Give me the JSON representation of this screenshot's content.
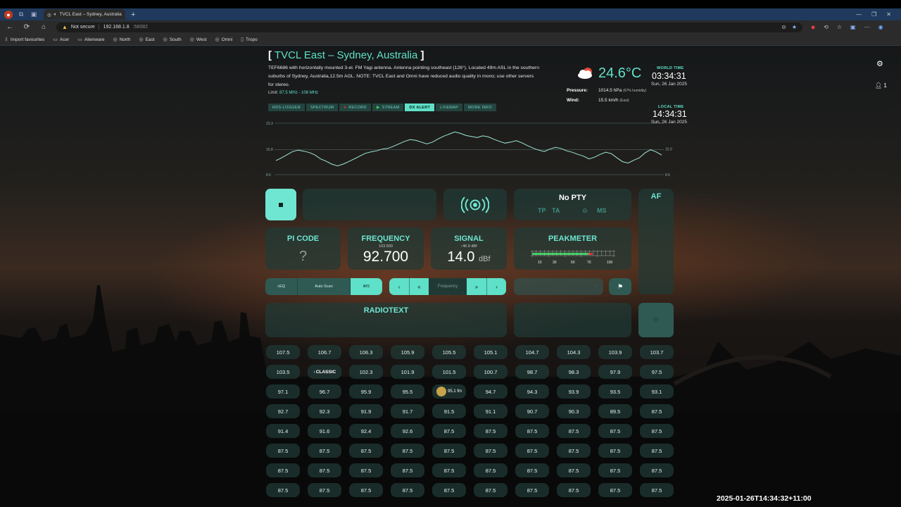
{
  "browser": {
    "tab_title": "TVCL East – Sydney, Australia",
    "security_label": "Not secure",
    "url_host": "192.168.1.8",
    "url_port": ":58082",
    "bookmarks": [
      {
        "label": "Import favourites",
        "icon": "import-icon"
      },
      {
        "label": "Acer",
        "icon": "folder-icon"
      },
      {
        "label": "Alienware",
        "icon": "folder-icon"
      },
      {
        "label": "North",
        "icon": "globe-icon"
      },
      {
        "label": "East",
        "icon": "globe-icon"
      },
      {
        "label": "South",
        "icon": "globe-icon"
      },
      {
        "label": "West",
        "icon": "globe-icon"
      },
      {
        "label": "Omni",
        "icon": "globe-icon"
      },
      {
        "label": "Tropo",
        "icon": "page-icon"
      }
    ]
  },
  "header": {
    "title": "TVCL East – Sydney, Australia",
    "description": "TEF6686 with horizontally mounted 3-el. FM Yagi antenna. Antenna pointing southeast (126°). Located 49m ASL in the southern suburbs of Sydney, Australia,12.5m AGL. NOTE: TVCL East and Omni have reduced audio quality in mono; use other servers for stereo.",
    "limit_label": "Limit:",
    "limit_value": "87.5 MHz - 108 MHz"
  },
  "plugin_buttons": [
    {
      "label": "RDS-LOGGER",
      "active": false,
      "icon": ""
    },
    {
      "label": "SPECTRUM",
      "active": false,
      "icon": ""
    },
    {
      "label": "RECORD",
      "active": false,
      "icon": "record-icon"
    },
    {
      "label": "STREAM",
      "active": false,
      "icon": "play-icon"
    },
    {
      "label": "DX ALERT",
      "active": true,
      "icon": ""
    },
    {
      "label": "LIVEMAP",
      "active": false,
      "icon": ""
    },
    {
      "label": "MORE INFO",
      "active": false,
      "icon": ""
    }
  ],
  "graph": {
    "y_max": "23.3",
    "y_mid": "15.8",
    "y_min": "8.6",
    "right_mid": "15.9",
    "right_min": "8.6",
    "series": [
      12.6,
      13.4,
      14.3,
      15.2,
      15.6,
      15.3,
      14.9,
      14.2,
      13.1,
      12.4,
      11.6,
      11.1,
      11.6,
      12.3,
      13.1,
      13.9,
      14.7,
      15.1,
      15.4,
      15.9,
      16.1,
      16.7,
      17.4,
      18.1,
      18.6,
      18.4,
      17.9,
      17.4,
      17.9,
      18.8,
      19.6,
      20.2,
      20.8,
      20.4,
      19.8,
      19.5,
      19.2,
      19.7,
      19.4,
      18.7,
      18.1,
      17.6,
      17.9,
      18.3,
      17.7,
      16.9,
      16.2,
      15.6,
      15.2,
      15.9,
      16.4,
      16.1,
      15.4,
      15.0,
      14.4,
      13.9,
      13.1,
      13.6,
      14.4,
      15.0,
      14.6,
      13.4,
      12.3,
      11.9,
      12.7,
      13.4,
      14.8,
      15.7,
      15.1,
      14.2
    ]
  },
  "weather": {
    "icon": "partly-cloudy-icon",
    "temperature": "24.6°C",
    "pressure_label": "Pressure:",
    "pressure_value": "1014.5 hPa",
    "humidity": "(67% humidity)",
    "wind_label": "Wind:",
    "wind_value": "15.5 km/h",
    "wind_dir": "(East)"
  },
  "clock": {
    "world_label": "WORLD TIME",
    "world_time": "03:34:31",
    "world_date": "Sun, 26 Jan 2025",
    "local_label": "LOCAL TIME",
    "local_time": "14:34:31",
    "local_date": "Sun, 26 Jan 2025"
  },
  "users_count": "1",
  "tuner": {
    "pty": "No PTY",
    "tp": "TP",
    "ta": "TA",
    "ms": "MS",
    "af_label": "AF",
    "pi_label": "PI CODE",
    "pi_value": "?",
    "freq_label": "FREQUENCY",
    "freq_prev": "103.500",
    "freq_value": "92.700",
    "signal_label": "SIGNAL",
    "signal_peak": "46.9 dBf",
    "signal_value": "14.0",
    "signal_unit": "dBf",
    "peak_label": "PEAKMETER",
    "peak_scale": [
      "10",
      "30",
      "50",
      "70",
      "100"
    ],
    "radiotext_label": "RADIOTEXT",
    "freq_placeholder": "Frequency"
  },
  "toggles": [
    {
      "label": "cEQ",
      "on": false
    },
    {
      "label": "Auto Scan",
      "on": false
    },
    {
      "label": "iMS",
      "on": true
    }
  ],
  "presets": [
    "107.5",
    "106.7",
    "106.3",
    "105.9",
    "105.5",
    "105.1",
    "104.7",
    "104.3",
    "103.9",
    "103.7",
    "103.5",
    "LOGO1",
    "102.3",
    "101.9",
    "101.5",
    "100.7",
    "98.7",
    "98.3",
    "97.9",
    "97.5",
    "97.1",
    "96.7",
    "95.9",
    "95.5",
    "LOGO2",
    "94.7",
    "94.3",
    "93.9",
    "93.5",
    "93.1",
    "92.7",
    "92.3",
    "91.9",
    "91.7",
    "91.5",
    "91.1",
    "90.7",
    "90.3",
    "89.5",
    "87.5",
    "91.4",
    "91.6",
    "92.4",
    "92.6",
    "87.5",
    "87.5",
    "87.5",
    "87.5",
    "87.5",
    "87.5",
    "87.5",
    "87.5",
    "87.5",
    "87.5",
    "87.5",
    "87.5",
    "87.5",
    "87.5",
    "87.5",
    "87.5",
    "87.5",
    "87.5",
    "87.5",
    "87.5",
    "87.5",
    "87.5",
    "87.5",
    "87.5",
    "87.5",
    "87.5",
    "87.5",
    "87.5",
    "87.5",
    "87.5",
    "87.5",
    "87.5",
    "87.5",
    "87.5",
    "87.5",
    "87.5"
  ],
  "logo1_text": "CLASSIC",
  "logo2_text": "95.1 fm",
  "timestamp": "2025-01-26T14:34:32+11:00"
}
